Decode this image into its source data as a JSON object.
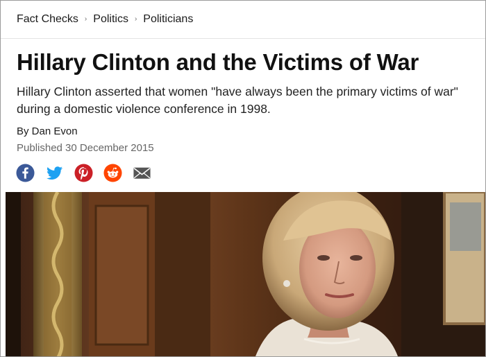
{
  "breadcrumb": {
    "items": [
      "Fact Checks",
      "Politics",
      "Politicians"
    ],
    "separator": "›"
  },
  "article": {
    "title": "Hillary Clinton and the Victims of War",
    "summary": "Hillary Clinton asserted that women \"have always been the primary victims of war\" during a domestic violence conference in 1998.",
    "byline": "By Dan Evon",
    "published": "Published 30 December 2015"
  },
  "share": {
    "icons": [
      "facebook-icon",
      "twitter-icon",
      "pinterest-icon",
      "reddit-icon",
      "email-icon"
    ],
    "colors": {
      "facebook": "#3b5998",
      "twitter": "#1da1f2",
      "pinterest": "#cb2027",
      "reddit": "#ff4500",
      "email": "#555555"
    }
  },
  "hero_image": {
    "subject": "woman-portrait-photo"
  }
}
